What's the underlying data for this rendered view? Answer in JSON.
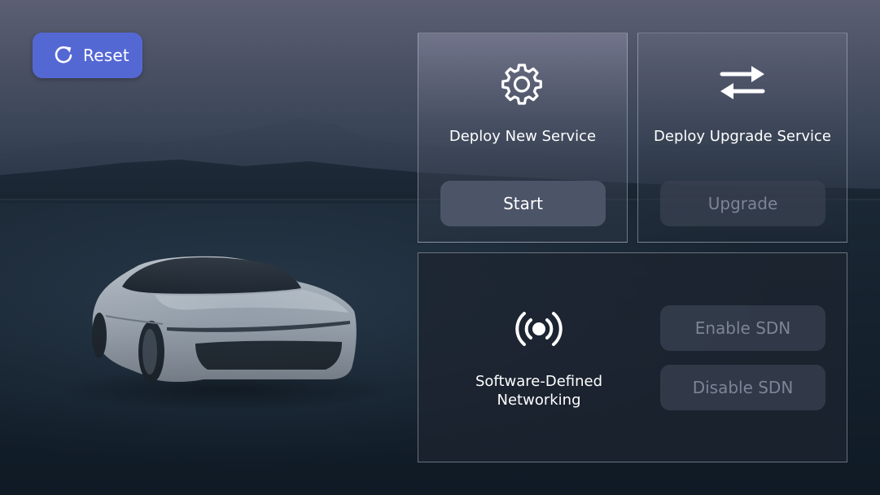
{
  "reset": {
    "label": "Reset",
    "icon": "refresh-icon",
    "color": "#5468d4"
  },
  "panels": {
    "deploy_new": {
      "title": "Deploy New Service",
      "icon": "gear-icon",
      "button": {
        "label": "Start",
        "enabled": true
      }
    },
    "deploy_upgrade": {
      "title": "Deploy Upgrade Service",
      "icon": "swap-arrows-icon",
      "button": {
        "label": "Upgrade",
        "enabled": false
      }
    },
    "sdn": {
      "title": "Software-Defined Networking",
      "icon": "broadcast-icon",
      "enable_button": {
        "label": "Enable SDN",
        "enabled": false
      },
      "disable_button": {
        "label": "Disable SDN",
        "enabled": false
      }
    }
  },
  "colors": {
    "accent": "#5468d4",
    "button_active": "#4c5468",
    "button_disabled_text": "#7c8496"
  }
}
